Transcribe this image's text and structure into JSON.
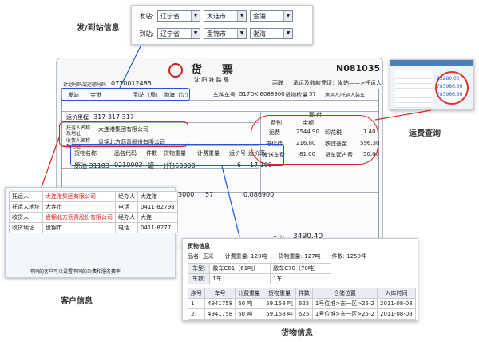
{
  "labels": {
    "station_info": "发/到站信息",
    "freight_query": "运费查询",
    "customer_info": "客户信息",
    "goods_info": "货物信息"
  },
  "station_selector": {
    "depart_label": "发站:",
    "arrive_label": "到站:",
    "depart": [
      "辽宁省",
      "大连市",
      "金港"
    ],
    "arrive": [
      "辽宁省",
      "盘锦市",
      "渤海"
    ]
  },
  "ticket": {
    "title": "货 票",
    "subtitle": "沈 阳 铁 路 局",
    "number": "N081035",
    "plan_no_label": "计划号码或运输号码",
    "plan_no": "0770012485",
    "copy_label": "丙联",
    "copy_desc": "承运及收款凭证：发站——>托运人",
    "from_label": "发站",
    "from_value": "金港",
    "to_label": "到站（局）",
    "to_value": "渤海（沈）",
    "car_type_label": "车种车号",
    "car_type": "G17DK 6088900",
    "load_label": "货物检量",
    "load": "57",
    "bearer_label": "承运人/托运人装车",
    "tariff_label": "运价里程",
    "tariff": "317 317 317",
    "shipper_label": "托运人名称及地址",
    "shipper": "大连港集团有限公司",
    "consignee_label": "收货人名称及地址",
    "consignee": "盘锦北方沥青股份有限公司",
    "fee_header": "现 付",
    "fee_cols": [
      "费别",
      "金额"
    ],
    "fees": [
      [
        "运费",
        "2544.90",
        "印花税",
        "1.40"
      ],
      [
        "电化费",
        "216.80",
        "铁建基金",
        "596.30"
      ],
      [
        "发送车费",
        "81.00",
        "货车延占费",
        "50.00"
      ]
    ],
    "goods_headers": [
      "货物名称",
      "品名代码",
      "件数",
      "货物重量",
      "计费重量",
      "运价号",
      "运价率"
    ],
    "goods_row": [
      "原油 31103",
      "0210003",
      "罐",
      "(托)50000",
      "",
      "6",
      "17.100"
    ],
    "extra_values": [
      "3000",
      "57",
      "0.086900"
    ],
    "total_label": "合 计",
    "total": "3490.40"
  },
  "freight_query_shot": {
    "values": [
      "93280.00",
      "783986.36",
      "783966.36"
    ]
  },
  "customer_shot": {
    "rows": [
      [
        "托运人",
        "大连港集团有限公司",
        "经办人",
        "大连港"
      ],
      [
        "托运人地址",
        "大连市",
        "电话",
        "0411-82798"
      ],
      [
        "收货人",
        "盘锦北方沥青股份有限公司",
        "经办人",
        "大连"
      ],
      [
        "收货地址",
        "盘锦市",
        "电话",
        "0411-8277"
      ]
    ],
    "caption": "不同的客户可以设置不同的杂费和服务费率"
  },
  "goods_panel": {
    "title": "货物信息",
    "summary": [
      [
        "品名:",
        "玉米"
      ],
      [
        "计费重量:",
        "120吨"
      ],
      [
        "货物重量:",
        "127吨"
      ],
      [
        "件数:",
        "1250件"
      ]
    ],
    "car_type_label": "车型:",
    "car_types": [
      "敞车C61（61吨）",
      "敞车C70（70吨）"
    ],
    "car_count_label": "车数:",
    "car_counts": [
      "1车",
      "1车"
    ],
    "headers": [
      "序号",
      "车号",
      "计费重量",
      "货物重量",
      "件数",
      "仓储位置",
      "入库时间"
    ],
    "rows": [
      [
        "1",
        "4941758",
        "60 吨",
        "59.158 吨",
        "625",
        "1号位堆>东一区>25-2",
        "2011-08-08"
      ],
      [
        "2",
        "4941758",
        "60 吨",
        "59.158 吨",
        "625",
        "1号位堆>东一区>25-2",
        "2011-08-08"
      ]
    ]
  },
  "colors": {
    "accent": "#2255dd",
    "highlight": "#dd2222"
  }
}
